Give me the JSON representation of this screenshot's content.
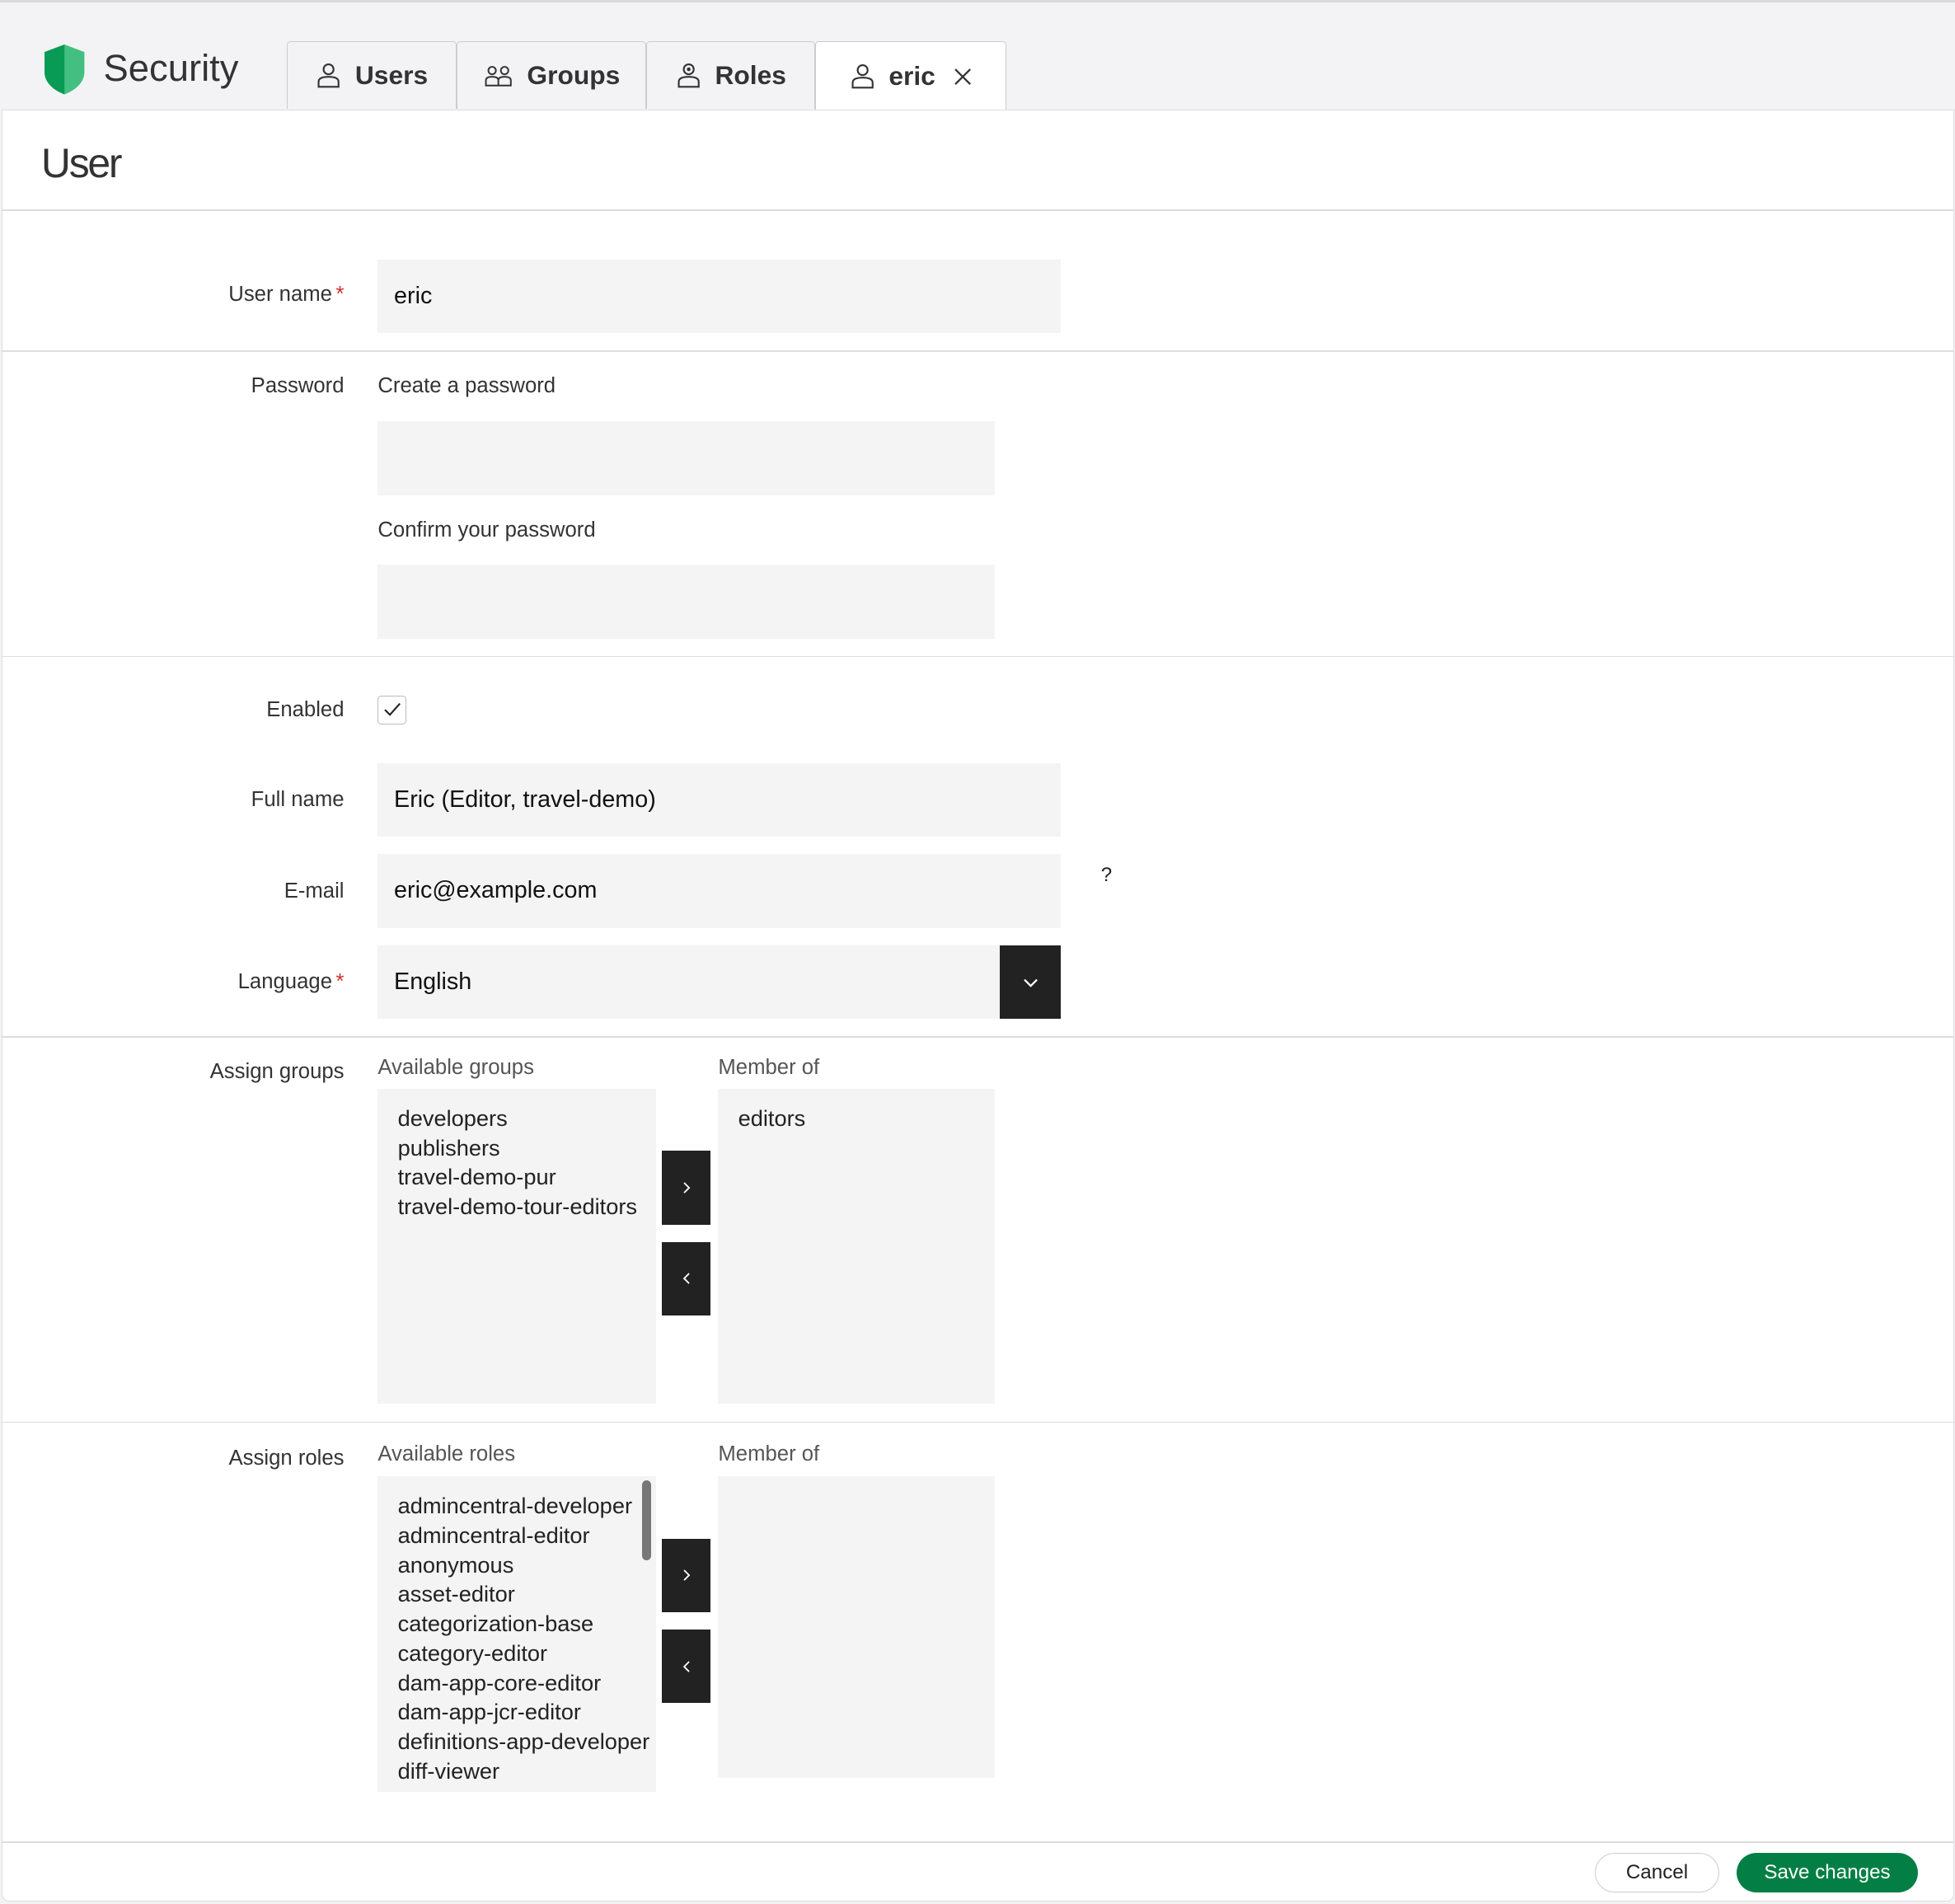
{
  "app": {
    "title": "Security",
    "accent": "#037f45"
  },
  "tabs": [
    {
      "label": "Users",
      "icon": "user-icon"
    },
    {
      "label": "Groups",
      "icon": "group-icon"
    },
    {
      "label": "Roles",
      "icon": "role-icon"
    },
    {
      "label": "eric",
      "icon": "user-icon",
      "active": true,
      "closable": true
    }
  ],
  "page": {
    "title": "User"
  },
  "form": {
    "username": {
      "label": "User name",
      "value": "eric",
      "required": "*"
    },
    "password": {
      "label": "Password",
      "create_label": "Create a password",
      "confirm_label": "Confirm your password",
      "value": "",
      "confirm_value": ""
    },
    "enabled": {
      "label": "Enabled",
      "checked": true
    },
    "fullname": {
      "label": "Full name",
      "value": "Eric (Editor, travel-demo)"
    },
    "email": {
      "label": "E-mail",
      "value": "eric@example.com",
      "help": "?"
    },
    "language": {
      "label": "Language",
      "value": "English",
      "required": "*"
    },
    "groups": {
      "label": "Assign groups",
      "available_label": "Available groups",
      "member_label": "Member of",
      "available": [
        "developers",
        "publishers",
        "travel-demo-pur",
        "travel-demo-tour-editors"
      ],
      "member": [
        "editors"
      ]
    },
    "roles": {
      "label": "Assign roles",
      "available_label": "Available roles",
      "member_label": "Member of",
      "available": [
        "admincentral-developer",
        "admincentral-editor",
        "anonymous",
        "asset-editor",
        "categorization-base",
        "category-editor",
        "dam-app-core-editor",
        "dam-app-jcr-editor",
        "definitions-app-developer",
        "diff-viewer"
      ],
      "member": []
    }
  },
  "footer": {
    "cancel": "Cancel",
    "save": "Save changes"
  }
}
